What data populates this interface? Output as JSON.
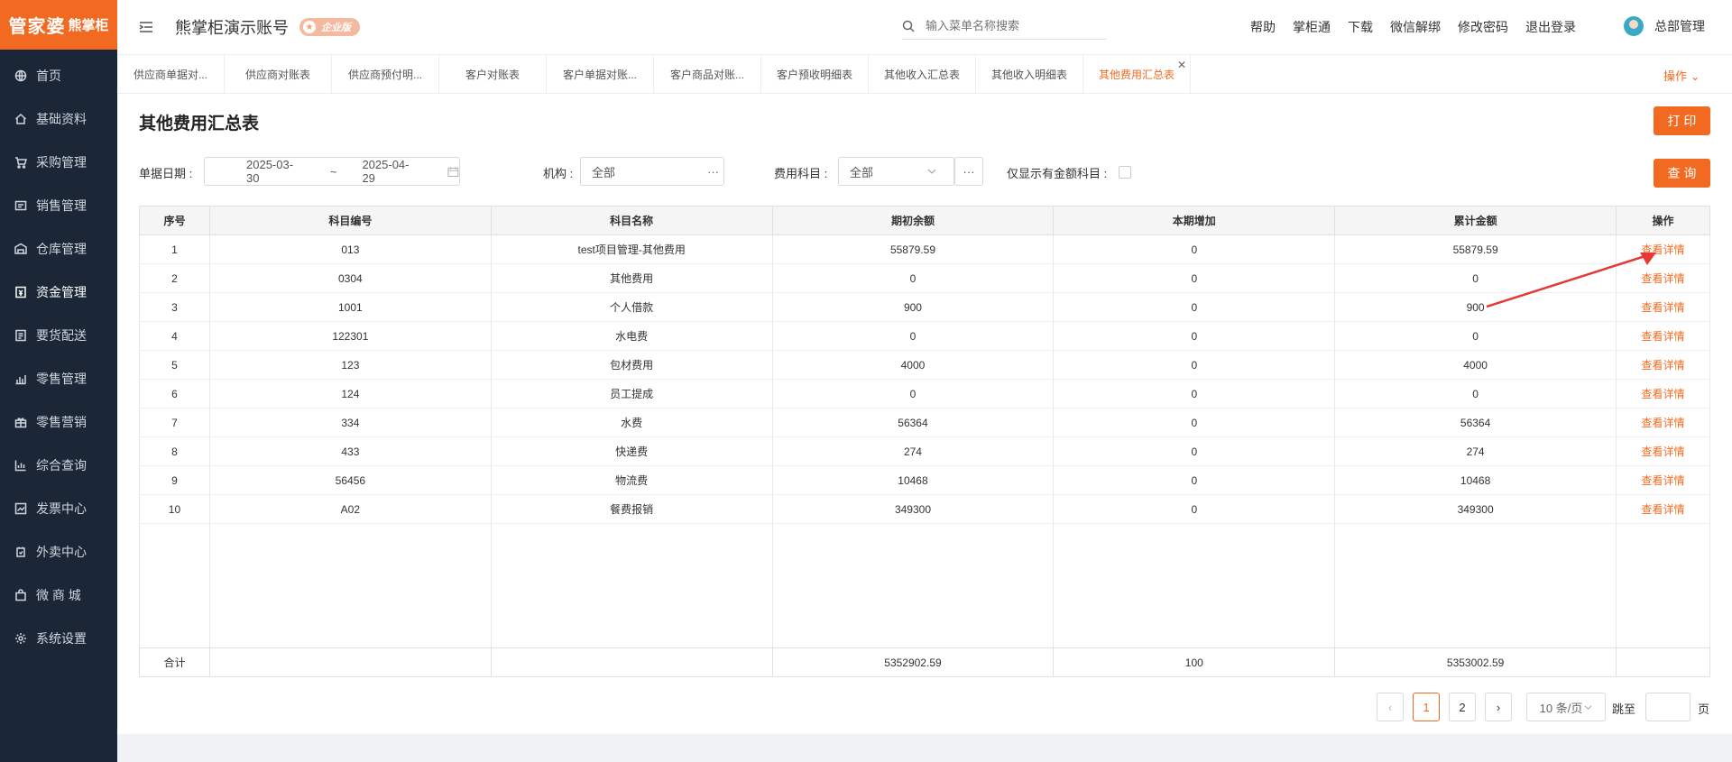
{
  "brand": {
    "logo_main": "管家婆",
    "logo_sub": "熊掌柜",
    "color": "#f26a21"
  },
  "sidebar": {
    "items": [
      {
        "label": "首页",
        "icon": "globe-icon"
      },
      {
        "label": "基础资料",
        "icon": "home-icon"
      },
      {
        "label": "采购管理",
        "icon": "cart-icon"
      },
      {
        "label": "销售管理",
        "icon": "sales-icon"
      },
      {
        "label": "仓库管理",
        "icon": "warehouse-icon"
      },
      {
        "label": "资金管理",
        "icon": "money-icon"
      },
      {
        "label": "要货配送",
        "icon": "list-icon"
      },
      {
        "label": "零售管理",
        "icon": "chart-icon"
      },
      {
        "label": "零售营销",
        "icon": "gift-icon"
      },
      {
        "label": "综合查询",
        "icon": "bar-chart-icon"
      },
      {
        "label": "发票中心",
        "icon": "trend-icon"
      },
      {
        "label": "外卖中心",
        "icon": "delivery-icon"
      },
      {
        "label": "微 商 城",
        "icon": "bag-icon"
      },
      {
        "label": "系统设置",
        "icon": "gear-icon"
      }
    ]
  },
  "header": {
    "account": "熊掌柜演示账号",
    "badge": "企业版",
    "search_placeholder": "输入菜单名称搜索",
    "links": [
      "帮助",
      "掌柜通",
      "下载",
      "微信解绑",
      "修改密码",
      "退出登录"
    ],
    "user": "总部管理"
  },
  "tabs": {
    "items": [
      "供应商单据对...",
      "供应商对账表",
      "供应商预付明...",
      "客户对账表",
      "客户单据对账...",
      "客户商品对账...",
      "客户预收明细表",
      "其他收入汇总表",
      "其他收入明细表",
      "其他费用汇总表"
    ],
    "active_index": 9,
    "ops_label": "操作 ⌄"
  },
  "page": {
    "title": "其他费用汇总表",
    "print_label": "打 印",
    "query_label": "查 询"
  },
  "filters": {
    "date_label": "单据日期 :",
    "date_start": "2025-03-30",
    "date_sep": "~",
    "date_end": "2025-04-29",
    "org_label": "机构 :",
    "org_value": "全部",
    "org_more": "···",
    "subject_label": "费用科目 :",
    "subject_value": "全部",
    "subject_more": "···",
    "only_amount_label": "仅显示有金额科目 :"
  },
  "table": {
    "headers": [
      "序号",
      "科目编号",
      "科目名称",
      "期初余额",
      "本期增加",
      "累计金额",
      "操作"
    ],
    "rows": [
      [
        "1",
        "013",
        "test项目管理-其他费用",
        "55879.59",
        "0",
        "55879.59",
        "查看详情"
      ],
      [
        "2",
        "0304",
        "其他费用",
        "0",
        "0",
        "0",
        "查看详情"
      ],
      [
        "3",
        "1001",
        "个人借款",
        "900",
        "0",
        "900",
        "查看详情"
      ],
      [
        "4",
        "122301",
        "水电费",
        "0",
        "0",
        "0",
        "查看详情"
      ],
      [
        "5",
        "123",
        "包材费用",
        "4000",
        "0",
        "4000",
        "查看详情"
      ],
      [
        "6",
        "124",
        "员工提成",
        "0",
        "0",
        "0",
        "查看详情"
      ],
      [
        "7",
        "334",
        "水费",
        "56364",
        "0",
        "56364",
        "查看详情"
      ],
      [
        "8",
        "433",
        "快递费",
        "274",
        "0",
        "274",
        "查看详情"
      ],
      [
        "9",
        "56456",
        "物流费",
        "10468",
        "0",
        "10468",
        "查看详情"
      ],
      [
        "10",
        "A02",
        "餐费报销",
        "349300",
        "0",
        "349300",
        "查看详情"
      ]
    ],
    "total": {
      "label": "合计",
      "opening": "5352902.59",
      "increase": "100",
      "cumulative": "5353002.59"
    }
  },
  "pagination": {
    "prev": "‹",
    "pages": [
      "1",
      "2"
    ],
    "current": "1",
    "next": "›",
    "page_size": "10 条/页",
    "jump_label": "跳至",
    "page_suffix": "页"
  }
}
